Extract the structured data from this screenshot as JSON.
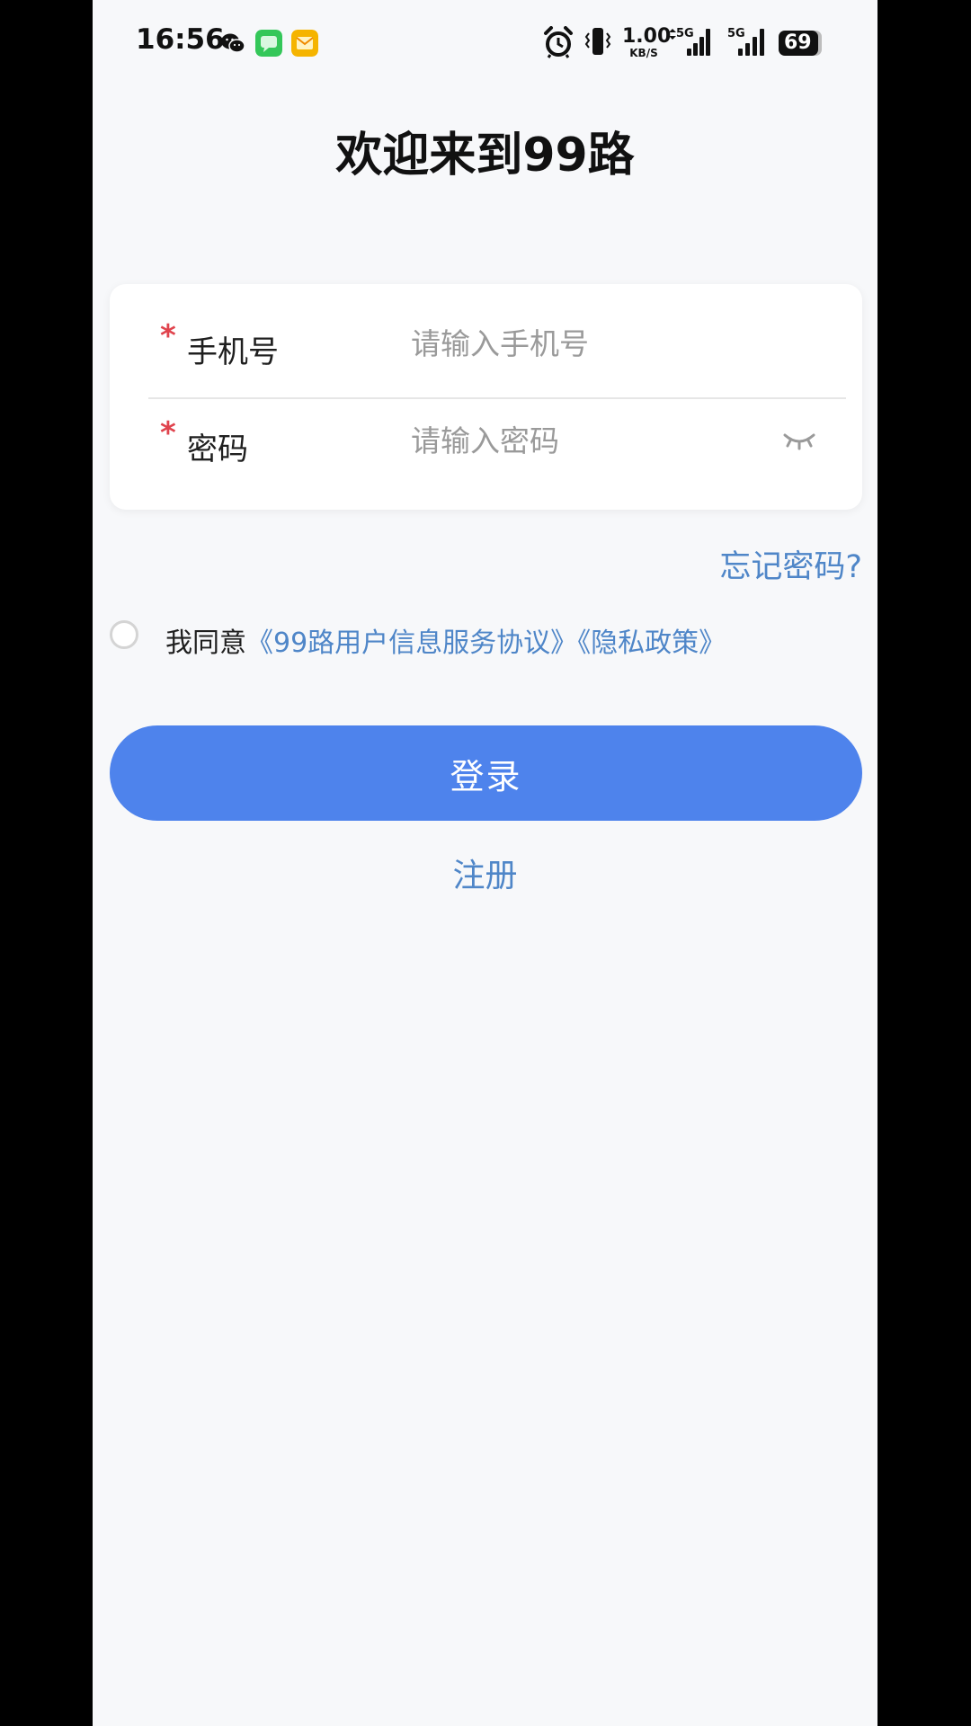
{
  "status_bar": {
    "time": "16:56",
    "apps": [
      "wechat-icon",
      "messages-icon",
      "mail-icon"
    ],
    "net_speed_value": "1.00",
    "net_speed_unit": "KB/S",
    "signal_1_label": "5G",
    "signal_2_label": "5G",
    "battery_level": "69",
    "colors": {
      "wechat": "#1aad19",
      "messages": "#34c759",
      "mail": "#f5b400"
    }
  },
  "header": {
    "title": "欢迎来到99路"
  },
  "form": {
    "phone": {
      "required_mark": "*",
      "label": "手机号",
      "placeholder": "请输入手机号",
      "value": ""
    },
    "password": {
      "required_mark": "*",
      "label": "密码",
      "placeholder": "请输入密码",
      "value": "",
      "toggle_icon": "eye-closed-icon"
    }
  },
  "forgot_password": "忘记密码?",
  "agreement": {
    "prefix": "我同意",
    "user_agreement": "《99路用户信息服务协议》",
    "privacy_policy": "《隐私政策》",
    "checked": false
  },
  "actions": {
    "login_label": "登录",
    "register_label": "注册",
    "primary_color": "#4e83ec",
    "link_color": "#4f86c8"
  }
}
